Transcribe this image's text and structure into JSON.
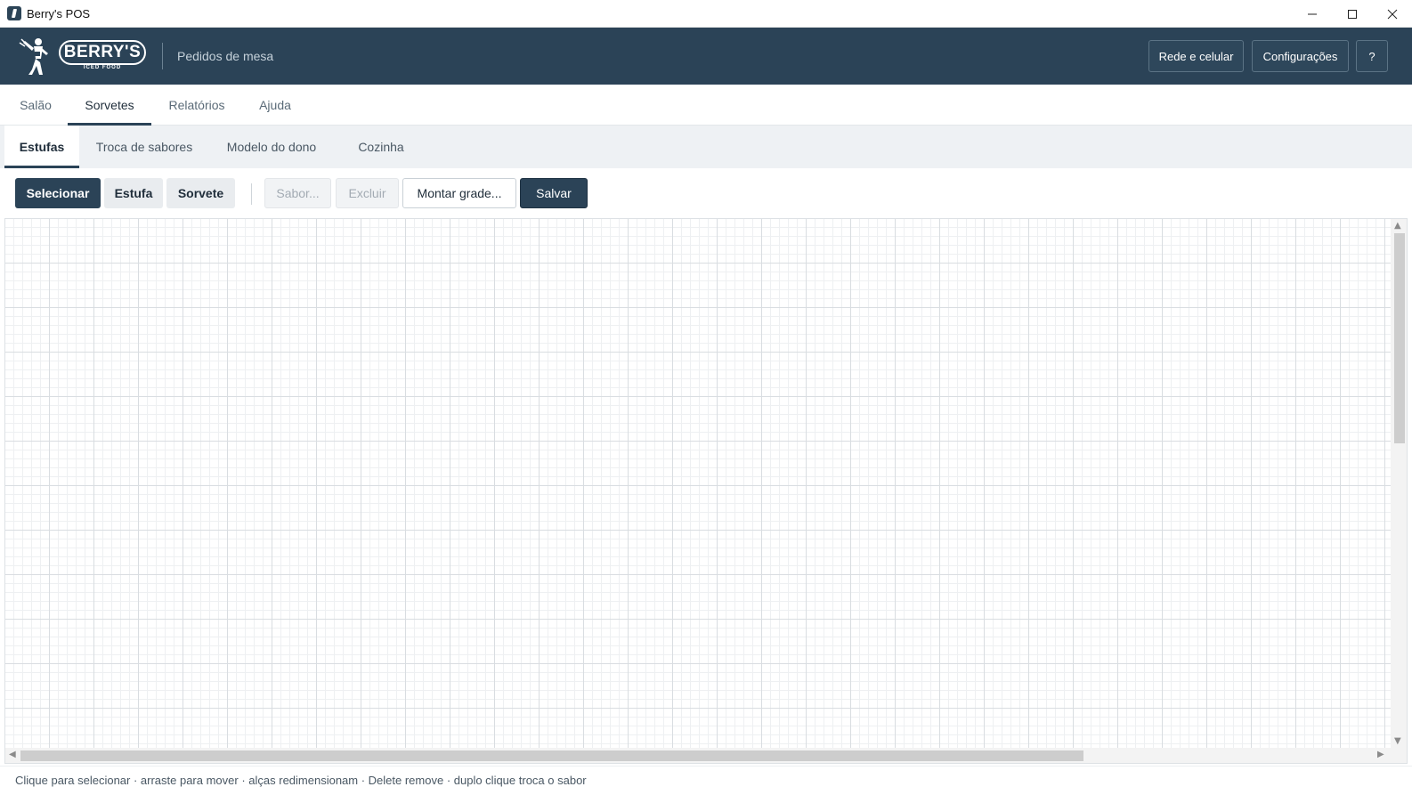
{
  "window": {
    "title": "Berry's POS",
    "icon": "app-icon"
  },
  "header": {
    "brand": "BERRY'S",
    "brand_sub": "ICED FOOD",
    "subtitle": "Pedidos de mesa",
    "buttons": {
      "network": "Rede e celular",
      "settings": "Configurações",
      "help": "?"
    },
    "colors": {
      "background": "#2b4357"
    }
  },
  "main_tabs": [
    {
      "label": "Salão",
      "active": false
    },
    {
      "label": "Sorvetes",
      "active": true
    },
    {
      "label": "Relatórios",
      "active": false
    },
    {
      "label": "Ajuda",
      "active": false
    }
  ],
  "sub_tabs": [
    {
      "label": "Estufas",
      "active": true
    },
    {
      "label": "Troca de sabores",
      "active": false
    },
    {
      "label": "Modelo do dono",
      "active": false
    },
    {
      "label": "Cozinha",
      "active": false
    }
  ],
  "toolbar": {
    "select": "Selecionar",
    "estufa": "Estufa",
    "sorvete": "Sorvete",
    "sabor": "Sabor...",
    "excluir": "Excluir",
    "montar": "Montar grade...",
    "salvar": "Salvar"
  },
  "status": {
    "hint": "Clique para selecionar · arraste para mover · alças redimensionam · Delete remove · duplo clique troca o sabor"
  }
}
